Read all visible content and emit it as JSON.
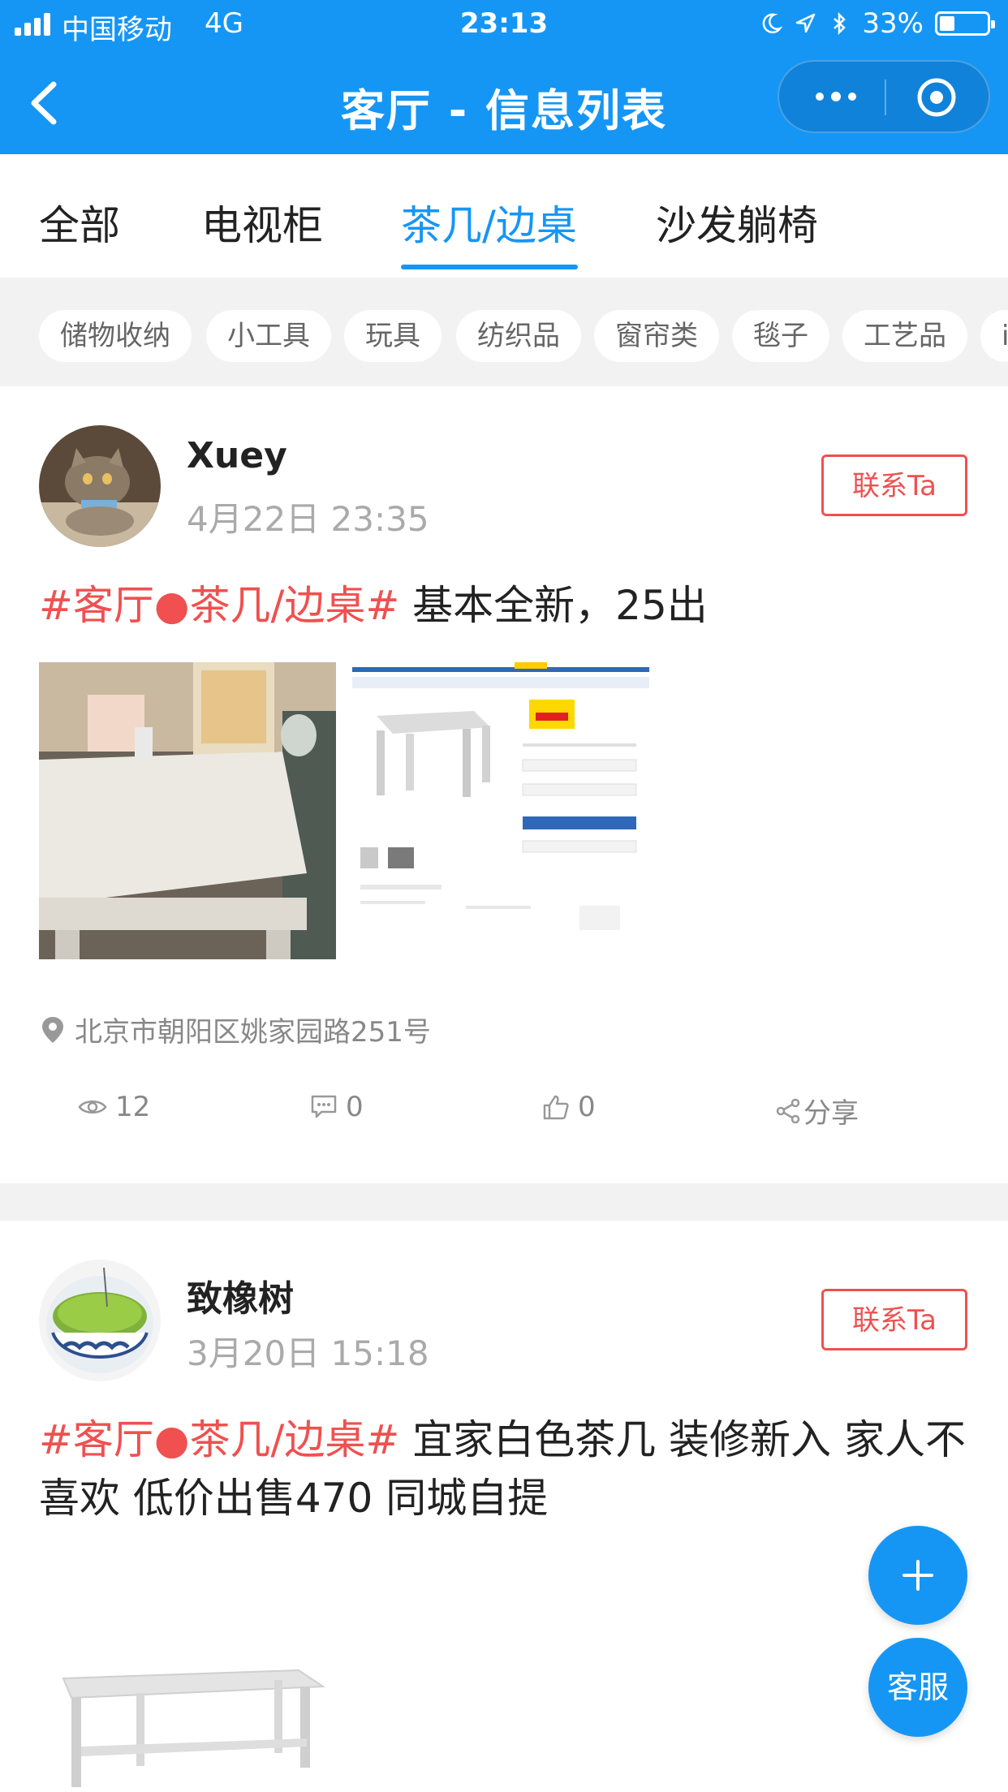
{
  "status_bar": {
    "carrier": "中国移动",
    "network": "4G",
    "time": "23:13",
    "battery": "33%",
    "battery_level": 0.33
  },
  "nav": {
    "title": "客厅 - 信息列表",
    "back_icon": "chevron-left-icon",
    "more_icon": "more-dots-icon",
    "target_icon": "target-icon"
  },
  "tabs": [
    {
      "label": "全部"
    },
    {
      "label": "电视柜"
    },
    {
      "label": "茶几/边桌"
    },
    {
      "label": "沙发躺椅"
    }
  ],
  "active_tab": 2,
  "chips": [
    "储物收纳",
    "小工具",
    "玩具",
    "纺织品",
    "窗帘类",
    "毯子",
    "工艺品",
    "i"
  ],
  "posts": [
    {
      "user": "Xuey",
      "time": "4月22日 23:35",
      "contact_label": "联系Ta",
      "tag": "#客厅●茶几/边桌#",
      "text": " 基本全新，25出",
      "location": "北京市朝阳区姚家园路251号",
      "views": "12",
      "comments": "0",
      "likes": "0",
      "share_label": "分享"
    },
    {
      "user": "致橡树",
      "time": "3月20日 15:18",
      "contact_label": "联系Ta",
      "tag": "#客厅●茶几/边桌#",
      "text": " 宜家白色茶几 装修新入 家人不喜欢 低价出售470 同城自提"
    }
  ],
  "fab": {
    "add_icon": "plus-icon",
    "service_label": "客服"
  },
  "colors": {
    "primary": "#1596f5",
    "tag_red": "#f05050",
    "background_gray": "#f2f2f2"
  }
}
